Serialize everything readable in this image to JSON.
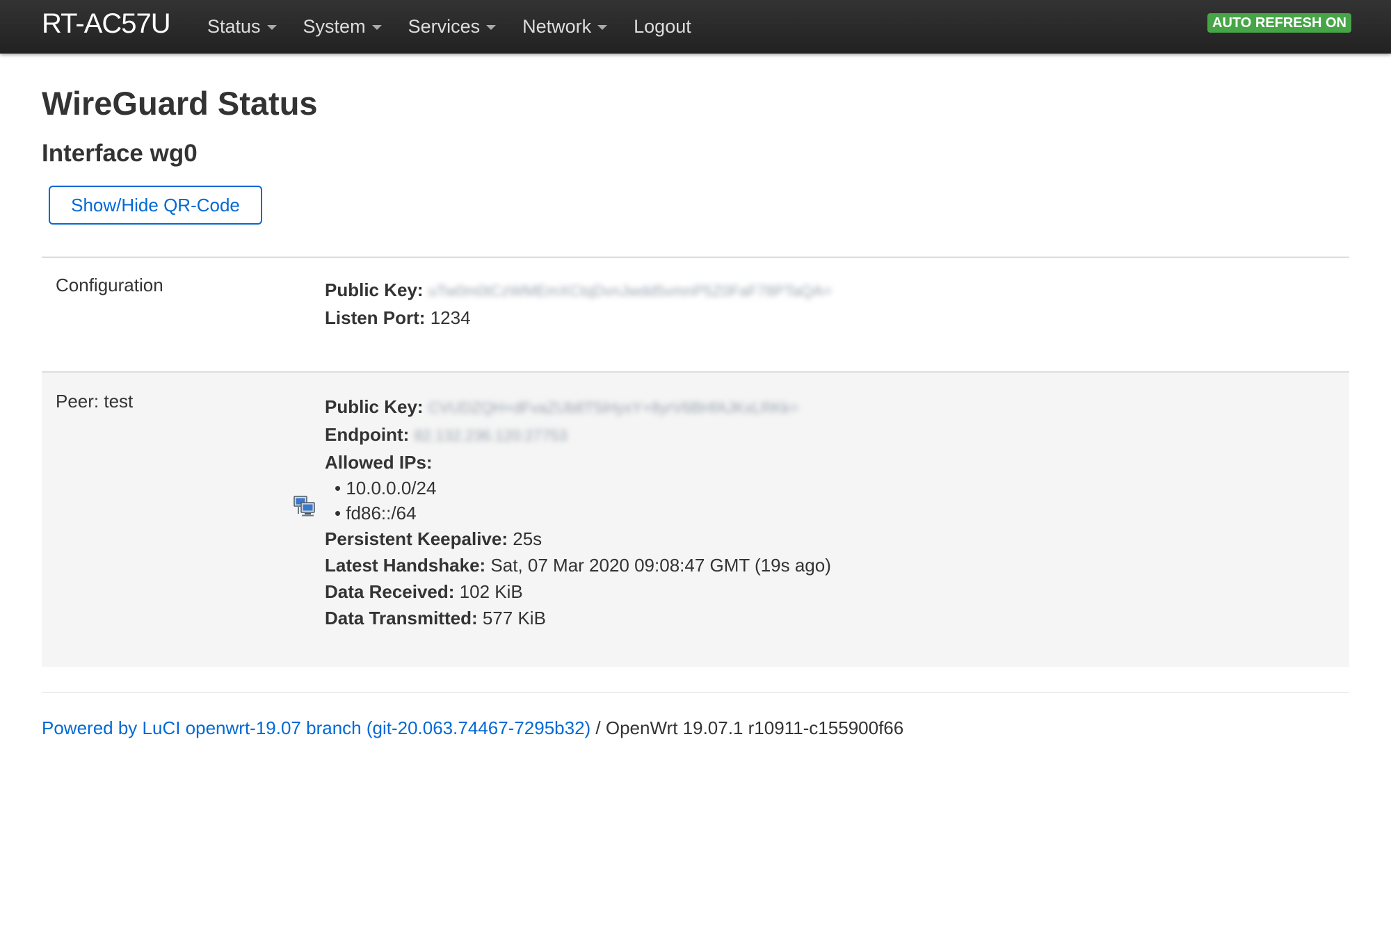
{
  "header": {
    "brand": "RT-AC57U",
    "nav": [
      {
        "label": "Status",
        "has_dropdown": true
      },
      {
        "label": "System",
        "has_dropdown": true
      },
      {
        "label": "Services",
        "has_dropdown": true
      },
      {
        "label": "Network",
        "has_dropdown": true
      },
      {
        "label": "Logout",
        "has_dropdown": false
      }
    ],
    "auto_refresh": "AUTO REFRESH ON"
  },
  "page": {
    "title": "WireGuard Status",
    "interface_title": "Interface wg0",
    "qr_button": "Show/Hide QR-Code"
  },
  "configuration": {
    "label": "Configuration",
    "public_key_label": "Public Key:",
    "public_key_value": "uTw0m0tCzWMEmXCtqDvnJwdd5vmnP5Z0FaF78PTaQA=",
    "listen_port_label": "Listen Port:",
    "listen_port_value": "1234"
  },
  "peer": {
    "label": "Peer: test",
    "icon": "network-computers-icon",
    "public_key_label": "Public Key:",
    "public_key_value": "CVUDZQH+dFvaZUb8T5iHyxY+8yrV6BHfAJKxLRKk=",
    "endpoint_label": "Endpoint:",
    "endpoint_value": "82.132.236.120:27753",
    "allowed_ips_label": "Allowed IPs:",
    "allowed_ips": [
      "10.0.0.0/24",
      "fd86::/64"
    ],
    "keepalive_label": "Persistent Keepalive:",
    "keepalive_value": "25s",
    "handshake_label": "Latest Handshake:",
    "handshake_value": "Sat, 07 Mar 2020 09:08:47 GMT (19s ago)",
    "received_label": "Data Received:",
    "received_value": "102 KiB",
    "transmitted_label": "Data Transmitted:",
    "transmitted_value": "577 KiB"
  },
  "footer": {
    "link_text": "Powered by LuCI openwrt-19.07 branch (git-20.063.74467-7295b32)",
    "version_text": " / OpenWrt 19.07.1 r10911-c155900f66"
  },
  "colors": {
    "navbar": "#222222",
    "link": "#0069d6",
    "badge": "#46a546",
    "peer_row": "#f5f5f5"
  }
}
